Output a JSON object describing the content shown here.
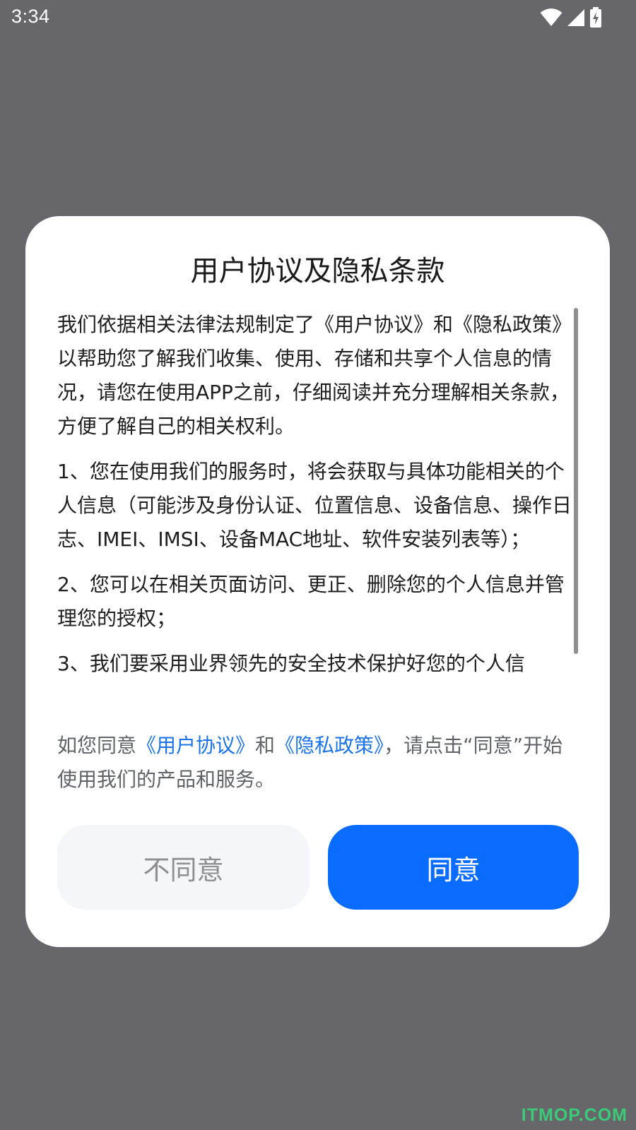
{
  "status_bar": {
    "time": "3:34",
    "icons": [
      "wifi-icon",
      "signal-icon",
      "battery-charging-icon"
    ]
  },
  "dialog": {
    "title": "用户协议及隐私条款",
    "paragraphs": [
      "我们依据相关法律法规制定了《用户协议》和《隐私政策》以帮助您了解我们收集、使用、存储和共享个人信息的情况，请您在使用APP之前，仔细阅读并充分理解相关条款，方便了解自己的相关权利。",
      "1、您在使用我们的服务时，将会获取与具体功能相关的个人信息（可能涉及身份认证、位置信息、设备信息、操作日志、IMEI、IMSI、设备MAC地址、软件安装列表等）；",
      "2、您可以在相关页面访问、更正、删除您的个人信息并管理您的授权；",
      "3、我们要采用业界领先的安全技术保护好您的个人信"
    ],
    "consent": {
      "prefix": "如您同意",
      "link_user_agreement": "《用户协议》",
      "middle": "和",
      "link_privacy_policy": "《隐私政策》",
      "suffix": "，请点击“同意”开始使用我们的产品和服务。"
    },
    "buttons": {
      "disagree": "不同意",
      "agree": "同意"
    }
  },
  "colors": {
    "backdrop": "#67666b",
    "dialog_bg": "#ffffff",
    "accent": "#0a6cff",
    "link": "#1a73e8",
    "secondary_button_bg": "#f4f6fa"
  },
  "watermark": "ITMOP.COM"
}
